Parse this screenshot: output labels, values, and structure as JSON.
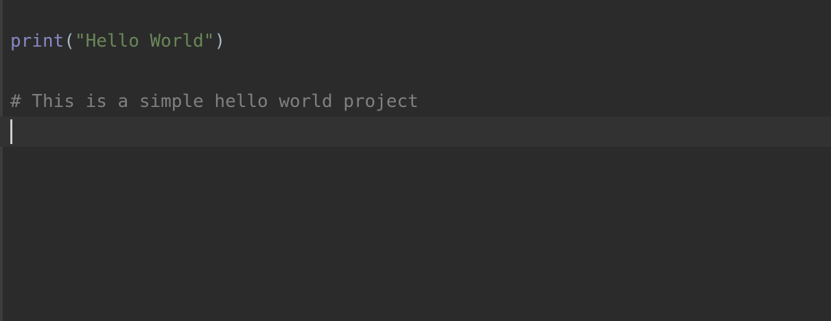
{
  "editor": {
    "lines": [
      {
        "builtin": "print",
        "open_paren": "(",
        "string": "\"Hello World\"",
        "close_paren": ")"
      },
      {
        "text": ""
      },
      {
        "comment": "# This is a simple hello world project"
      },
      {
        "text": ""
      }
    ]
  },
  "colors": {
    "background": "#2b2b2b",
    "current_line": "#323232",
    "builtin": "#8888c6",
    "string": "#6a8759",
    "comment": "#808080",
    "caret": "#cfcfcf"
  }
}
